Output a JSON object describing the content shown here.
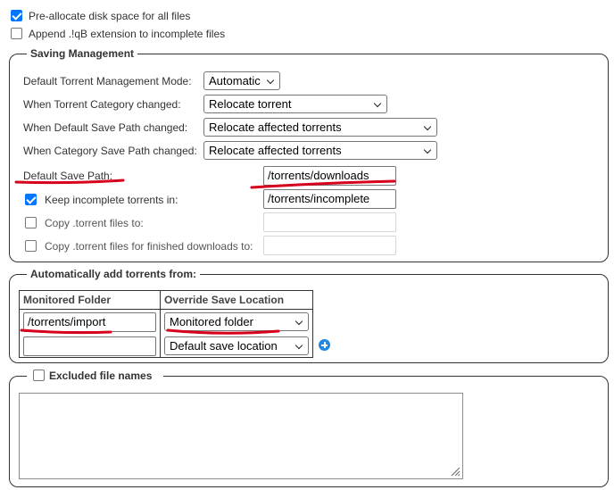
{
  "top_options": {
    "preallocate_label": "Pre-allocate disk space for all files",
    "preallocate_checked": true,
    "append_qb_label": "Append .!qB extension to incomplete files",
    "append_qb_checked": false
  },
  "saving_management": {
    "legend": "Saving Management",
    "mode_label": "Default Torrent Management Mode:",
    "mode_value": "Automatic",
    "category_changed_label": "When Torrent Category changed:",
    "category_changed_value": "Relocate torrent",
    "default_path_changed_label": "When Default Save Path changed:",
    "default_path_changed_value": "Relocate affected torrents",
    "category_path_changed_label": "When Category Save Path changed:",
    "category_path_changed_value": "Relocate affected torrents",
    "default_save_path_label": "Default Save Path:",
    "default_save_path_value": "/torrents/downloads",
    "keep_incomplete_label": "Keep incomplete torrents in:",
    "keep_incomplete_checked": true,
    "keep_incomplete_value": "/torrents/incomplete",
    "copy_torrent_label": "Copy .torrent files to:",
    "copy_torrent_checked": false,
    "copy_torrent_value": "",
    "copy_finished_label": "Copy .torrent files for finished downloads to:",
    "copy_finished_checked": false,
    "copy_finished_value": ""
  },
  "auto_add": {
    "legend": "Automatically add torrents from:",
    "col_monitored": "Monitored Folder",
    "col_override": "Override Save Location",
    "rows": [
      {
        "folder": "/torrents/import",
        "location": "Monitored folder"
      },
      {
        "folder": "",
        "location": "Default save location"
      }
    ]
  },
  "excluded": {
    "legend": "Excluded file names",
    "checked": false,
    "text": ""
  },
  "colors": {
    "accent": "#0075ff",
    "annotation_red": "#d6001c",
    "add_button": "#1e88e5"
  }
}
